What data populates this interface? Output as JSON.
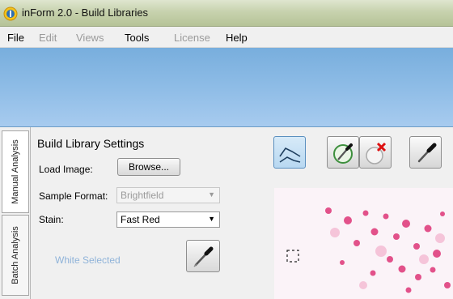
{
  "window": {
    "title": "inForm 2.0 - Build Libraries"
  },
  "menu": [
    {
      "label": "File",
      "enabled": true
    },
    {
      "label": "Edit",
      "enabled": false
    },
    {
      "label": "Views",
      "enabled": false
    },
    {
      "label": "Tools",
      "enabled": true
    },
    {
      "label": "License",
      "enabled": false
    },
    {
      "label": "Help",
      "enabled": true
    }
  ],
  "side_tabs": {
    "manual": "Manual Analysis",
    "batch": "Batch Analysis"
  },
  "panel": {
    "title": "Build Library Settings",
    "load_image_label": "Load Image:",
    "browse_label": "Browse...",
    "sample_format_label": "Sample Format:",
    "sample_format_value": "Brightfield",
    "stain_label": "Stain:",
    "stain_value": "Fast Red",
    "white_selected": "White Selected"
  },
  "icons": {
    "spectrum": "spectrum-graph-icon",
    "select_spectrum": "select-spectrum-icon",
    "delete_spectrum": "delete-spectrum-icon",
    "eyedropper": "eyedropper-icon"
  },
  "colors": {
    "title_bar": "#c7d2ae",
    "ribbon": "#8ebce6",
    "stain": "#e0407f",
    "white_selected": "#8fb3d9"
  }
}
